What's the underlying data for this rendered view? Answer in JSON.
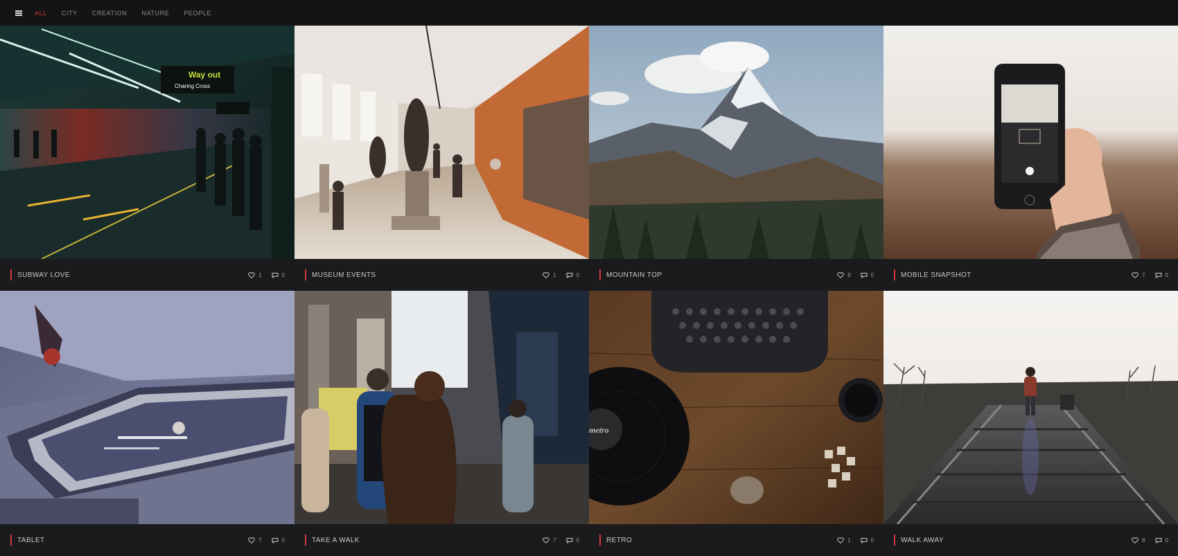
{
  "nav": {
    "menu_icon": "hamburger-icon",
    "filters": [
      "ALL",
      "CITY",
      "CREATION",
      "NATURE",
      "PEOPLE"
    ],
    "active_filter": "ALL"
  },
  "colors": {
    "accent": "#d23b3b",
    "background": "#19191b",
    "caption_bg": "#1b1b1d"
  },
  "items": [
    {
      "title": "SUBWAY LOVE",
      "likes": "1",
      "comments": "0"
    },
    {
      "title": "MUSEUM EVENTS",
      "likes": "1",
      "comments": "0"
    },
    {
      "title": "MOUNTAIN TOP",
      "likes": "8",
      "comments": "0"
    },
    {
      "title": "MOBILE SNAPSHOT",
      "likes": "7",
      "comments": "0"
    },
    {
      "title": "TABLET",
      "likes": "7",
      "comments": "0"
    },
    {
      "title": "TAKE A WALK",
      "likes": "7",
      "comments": "0"
    },
    {
      "title": "RETRO",
      "likes": "1",
      "comments": "0"
    },
    {
      "title": "WALK AWAY",
      "likes": "8",
      "comments": "0"
    }
  ],
  "photo_texts": {
    "way_out": "Way out",
    "charing_cross": "Charing Cross",
    "metro": "metro"
  }
}
